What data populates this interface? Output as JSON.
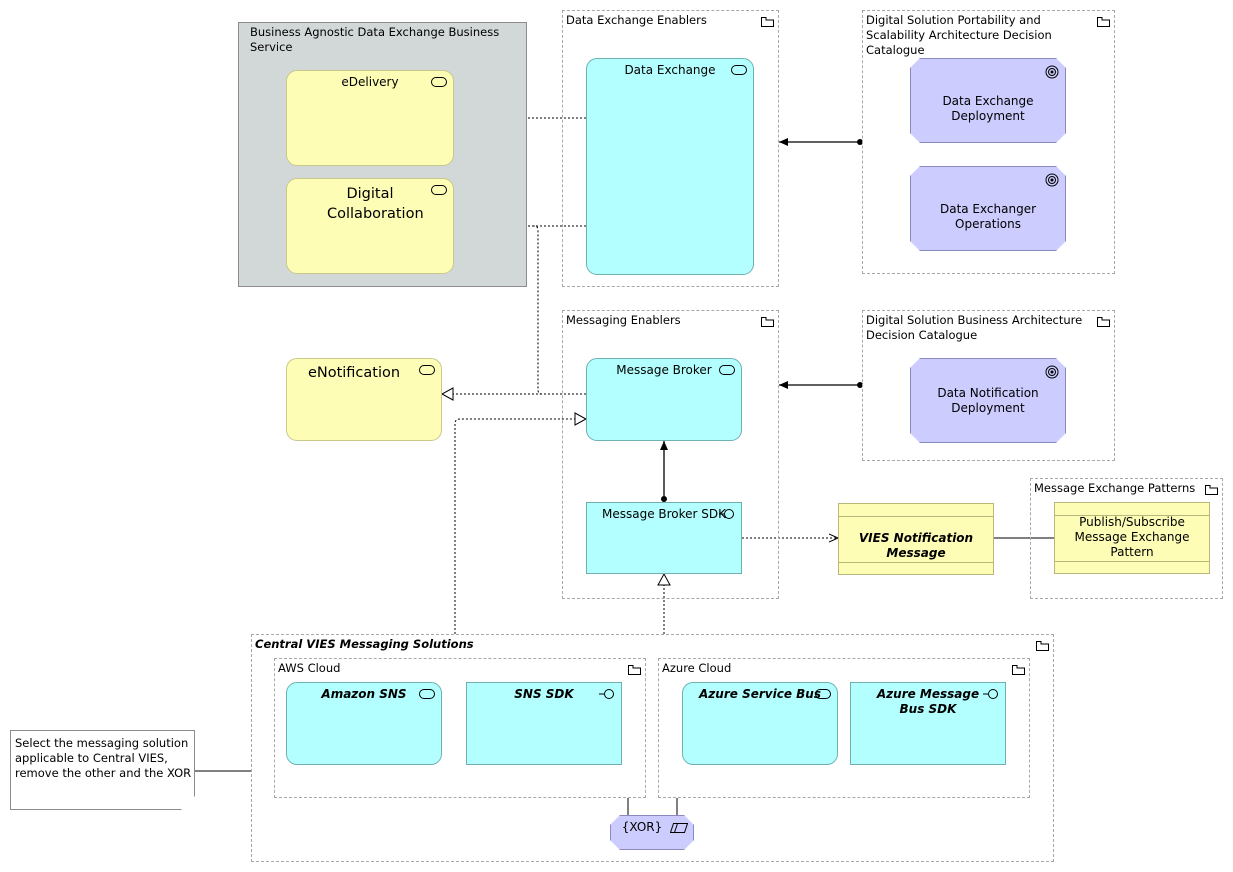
{
  "diagram": {
    "groups": {
      "business_service": {
        "label": "Business Agnostic Data Exchange Business Service"
      },
      "data_exchange_enablers": {
        "label": "Data Exchange Enablers"
      },
      "portability_catalogue": {
        "label": "Digital Solution Portability and Scalability Architecture Decision Catalogue"
      },
      "messaging_enablers": {
        "label": "Messaging Enablers"
      },
      "business_arch_catalogue": {
        "label": "Digital Solution Business Architecture Decision Catalogue"
      },
      "message_exchange_patterns": {
        "label": "Message Exchange Patterns"
      },
      "central_vies": {
        "label": "Central VIES Messaging Solutions"
      },
      "aws_cloud": {
        "label": "AWS Cloud"
      },
      "azure_cloud": {
        "label": "Azure Cloud"
      }
    },
    "elements": {
      "edelivery": {
        "label": "eDelivery",
        "type": "business-service"
      },
      "digital_collaboration": {
        "label": "Digital Collaboration",
        "type": "business-service"
      },
      "enotification": {
        "label": "eNotification",
        "type": "business-service"
      },
      "data_exchange": {
        "label": "Data Exchange",
        "type": "application-service"
      },
      "message_broker": {
        "label": "Message Broker",
        "type": "application-service"
      },
      "message_broker_sdk": {
        "label": "Message Broker SDK",
        "type": "application-interface"
      },
      "data_exchange_deployment": {
        "label": "Data Exchange Deployment",
        "type": "goal"
      },
      "data_exchanger_operations": {
        "label": "Data Exchanger Operations",
        "type": "goal"
      },
      "data_notification_deployment": {
        "label": "Data Notification Deployment",
        "type": "goal"
      },
      "vies_notification_message": {
        "label": "VIES Notification Message",
        "type": "data-object"
      },
      "pubsub_pattern": {
        "label": "Publish/Subscribe Message Exchange Pattern",
        "type": "data-object"
      },
      "amazon_sns": {
        "label": "Amazon SNS",
        "type": "application-service"
      },
      "sns_sdk": {
        "label": "SNS SDK",
        "type": "application-interface"
      },
      "azure_service_bus": {
        "label": "Azure Service Bus",
        "type": "application-service"
      },
      "azure_message_bus_sdk": {
        "label": "Azure Message Bus SDK",
        "type": "application-interface"
      },
      "xor": {
        "label": "{XOR}",
        "type": "constraint"
      }
    },
    "note": {
      "text": "Select the messaging solution applicable to Central VIES, remove the other and the XOR"
    },
    "relationships": [
      {
        "from": "data_exchange",
        "to": "edelivery",
        "type": "realization"
      },
      {
        "from": "data_exchange",
        "to": "digital_collaboration",
        "type": "realization"
      },
      {
        "from": "message_broker",
        "to": "digital_collaboration",
        "type": "realization"
      },
      {
        "from": "message_broker",
        "to": "enotification",
        "type": "realization"
      },
      {
        "from": "central_vies",
        "to": "message_broker",
        "type": "realization"
      },
      {
        "from": "central_vies",
        "to": "message_broker_sdk",
        "type": "realization"
      },
      {
        "from": "message_broker_sdk",
        "to": "message_broker",
        "type": "assignment"
      },
      {
        "from": "portability_catalogue",
        "to": "data_exchange_enablers",
        "type": "assignment"
      },
      {
        "from": "business_arch_catalogue",
        "to": "messaging_enablers",
        "type": "assignment"
      },
      {
        "from": "message_broker_sdk",
        "to": "vies_notification_message",
        "type": "access"
      },
      {
        "from": "vies_notification_message",
        "to": "pubsub_pattern",
        "type": "association"
      },
      {
        "from": "note",
        "to": "central_vies",
        "type": "association"
      },
      {
        "from": "xor",
        "to": "aws_cloud",
        "type": "association"
      },
      {
        "from": "xor",
        "to": "azure_cloud",
        "type": "association"
      }
    ]
  }
}
